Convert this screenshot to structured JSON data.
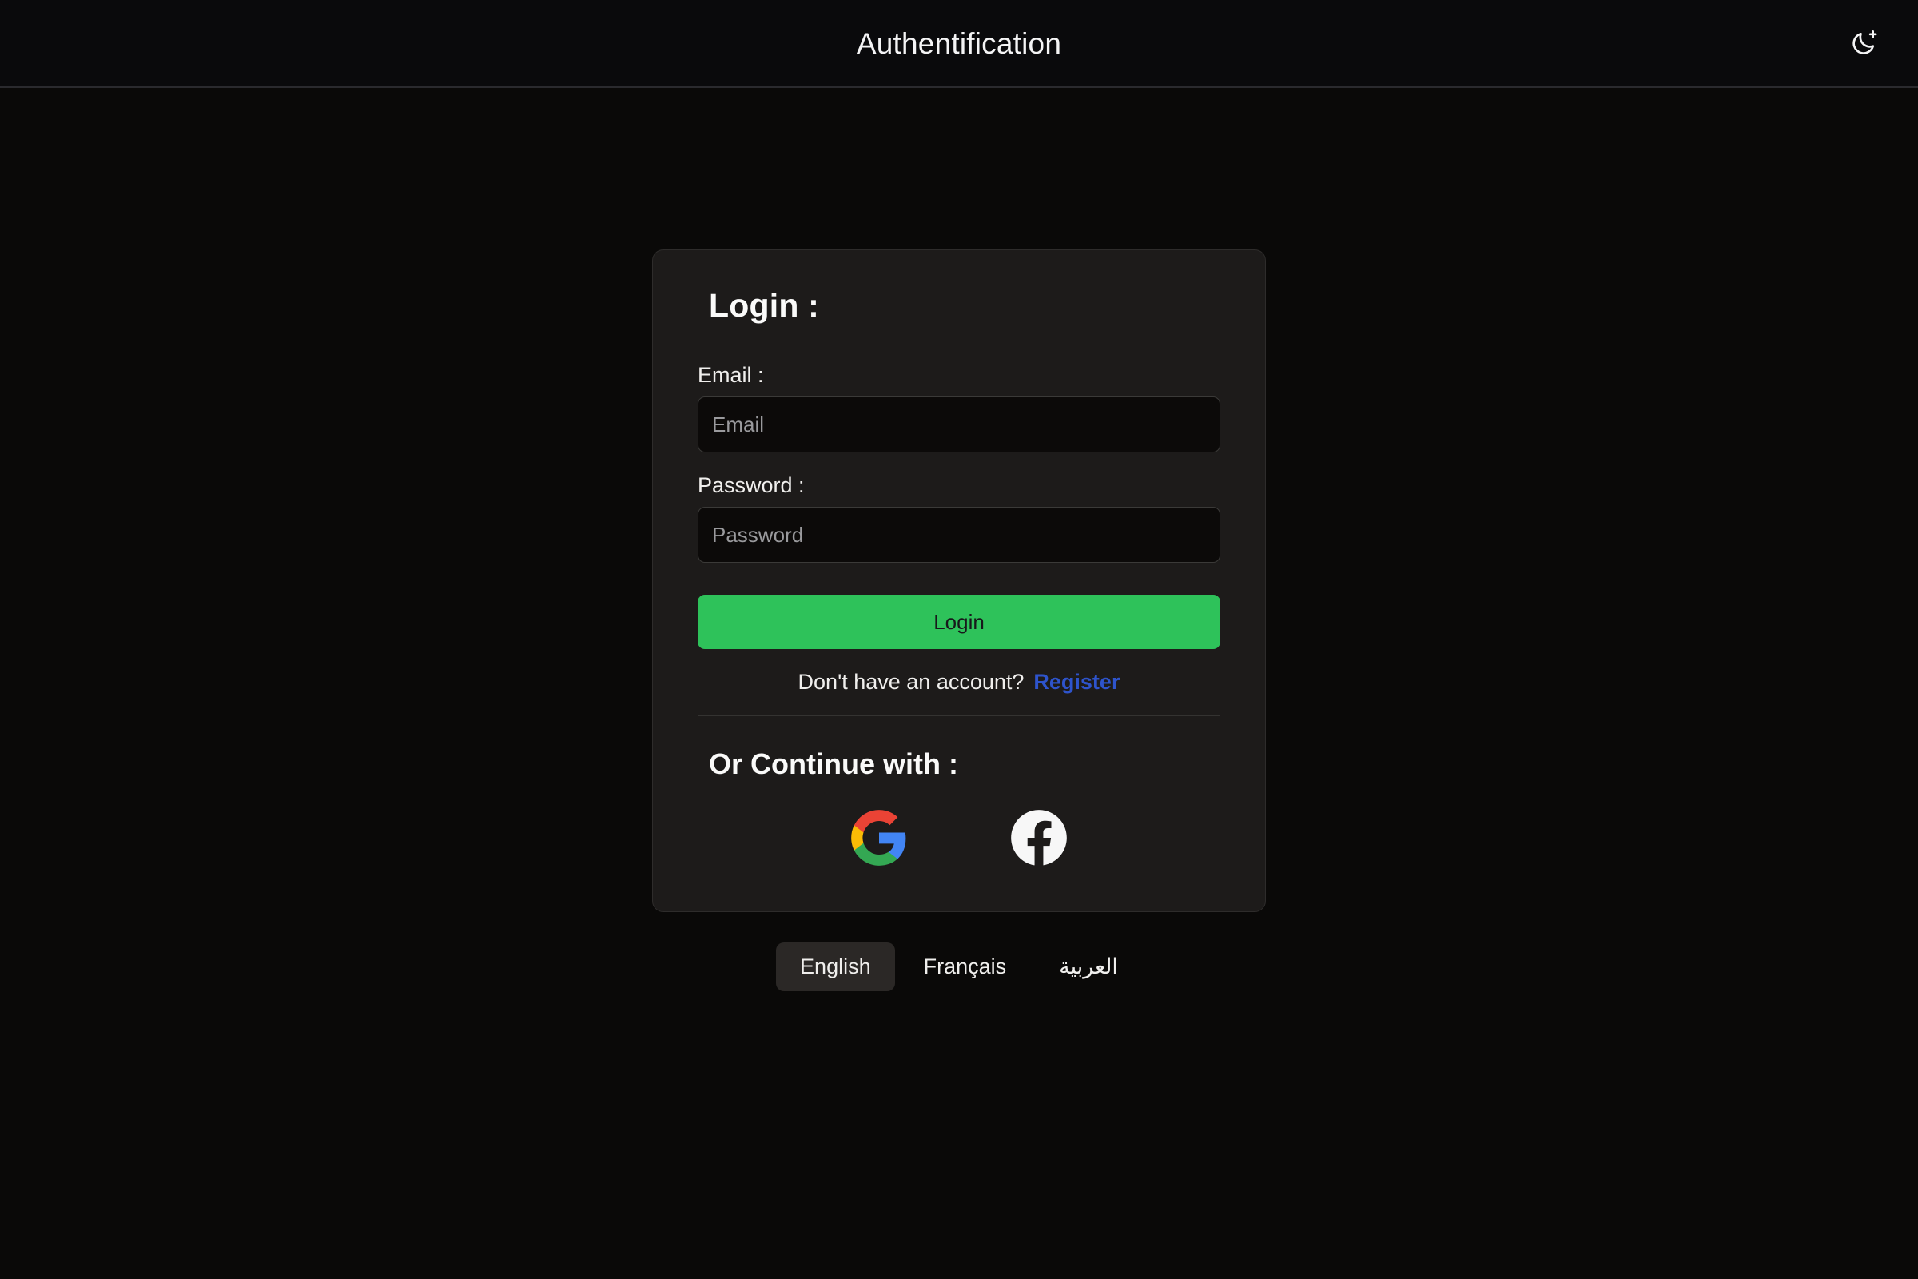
{
  "header": {
    "title": "Authentification",
    "theme_toggle_icon": "moon-plus-icon"
  },
  "card": {
    "title": "Login :",
    "email": {
      "label": "Email :",
      "placeholder": "Email",
      "value": ""
    },
    "password": {
      "label": "Password :",
      "placeholder": "Password",
      "value": ""
    },
    "submit_label": "Login",
    "register_prompt": "Don't have an account?",
    "register_link": "Register",
    "continue_title": "Or Continue with :",
    "social": [
      {
        "name": "google-icon",
        "label": "Google"
      },
      {
        "name": "facebook-icon",
        "label": "Facebook"
      }
    ]
  },
  "languages": [
    {
      "label": "English",
      "active": true,
      "rtl": false
    },
    {
      "label": "Français",
      "active": false,
      "rtl": false
    },
    {
      "label": "العربية",
      "active": false,
      "rtl": true
    }
  ],
  "colors": {
    "page_background": "#0a0908",
    "header_background": "#0a0a0c",
    "card_background": "#1d1b1a",
    "input_background": "#0c0a09",
    "submit_green": "#2ec25a",
    "register_blue": "#2e54cc",
    "text_primary": "#f0efed",
    "placeholder": "#9a9a9d",
    "google_red": "#ea4335",
    "google_yellow": "#fbbc05",
    "google_green": "#34a853",
    "google_blue": "#4285f4",
    "facebook_white": "#f7f7f7",
    "lang_active_background": "#2b2826"
  }
}
